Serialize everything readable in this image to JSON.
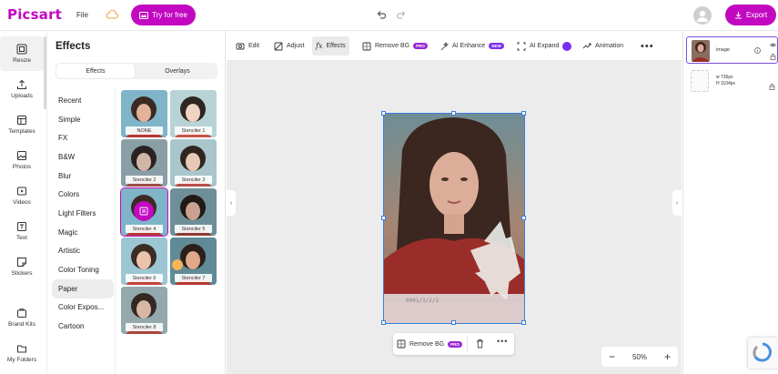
{
  "header": {
    "logo": "Picsart",
    "file_menu": "File",
    "try_free": "Try for free",
    "export": "Export"
  },
  "rail": {
    "items": [
      {
        "label": "Resize",
        "icon": "resize-icon"
      },
      {
        "label": "Uploads",
        "icon": "upload-icon"
      },
      {
        "label": "Templates",
        "icon": "templates-icon"
      },
      {
        "label": "Photos",
        "icon": "photos-icon"
      },
      {
        "label": "Videos",
        "icon": "videos-icon"
      },
      {
        "label": "Text",
        "icon": "text-icon"
      },
      {
        "label": "Stickers",
        "icon": "stickers-icon"
      },
      {
        "label": "Brand Kits",
        "icon": "brand-kits-icon"
      },
      {
        "label": "My Folders",
        "icon": "folder-icon"
      }
    ]
  },
  "panel": {
    "title": "Effects",
    "tabs": [
      "Effects",
      "Overlays"
    ],
    "active_tab": "Effects",
    "categories": [
      "Recent",
      "Simple",
      "FX",
      "B&W",
      "Blur",
      "Colors",
      "Light Filters",
      "Magic",
      "Artistic",
      "Color Toning",
      "Paper",
      "Color Expos...",
      "Cartoon"
    ],
    "active_category": "Paper",
    "thumbnails": [
      "NONE",
      "Stenciler 1",
      "Stenciler 2",
      "Stenciler 3",
      "Stenciler 4",
      "Stenciler 5",
      "Stenciler 6",
      "Stenciler 7",
      "Stenciler 8"
    ],
    "selected_thumbnail": "Stenciler 4"
  },
  "toolbar": {
    "edit": "Edit",
    "adjust": "Adjust",
    "effects": "Effects",
    "remove_bg": "Remove BG",
    "remove_bg_badge": "PRO",
    "ai_enhance": "AI Enhance",
    "ai_enhance_badge": "NEW",
    "ai_expand": "AI Expand",
    "animation": "Animation"
  },
  "canvas": {
    "context_remove_bg": "Remove BG",
    "context_badge": "PRO",
    "zoom": "50%",
    "photo_stamp": "0001/3/2/2"
  },
  "layers": {
    "image_layer": "image",
    "background_width": "w  736px",
    "background_height": "H  1104px"
  },
  "colors": {
    "brand": "#c209c1",
    "selection": "#3b7ddd",
    "badge_new": "#7a2ff0"
  }
}
